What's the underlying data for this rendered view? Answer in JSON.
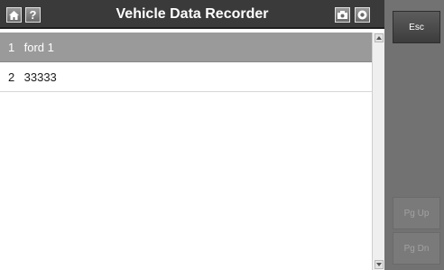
{
  "header": {
    "title": "Vehicle Data Recorder",
    "home_icon": "home-icon",
    "help_label": "?",
    "camera_icon": "camera-icon",
    "record_icon": "record-icon"
  },
  "list": {
    "items": [
      {
        "index": "1",
        "label": "ford 1",
        "selected": true
      },
      {
        "index": "2",
        "label": "33333",
        "selected": false
      }
    ]
  },
  "sidebar": {
    "esc_label": "Esc",
    "pgup_label": "Pg Up",
    "pgdn_label": "Pg Dn"
  },
  "colors": {
    "titlebar": "#3a3a3a",
    "selected_row": "#9a9a9a",
    "sidepanel": "#727272"
  }
}
